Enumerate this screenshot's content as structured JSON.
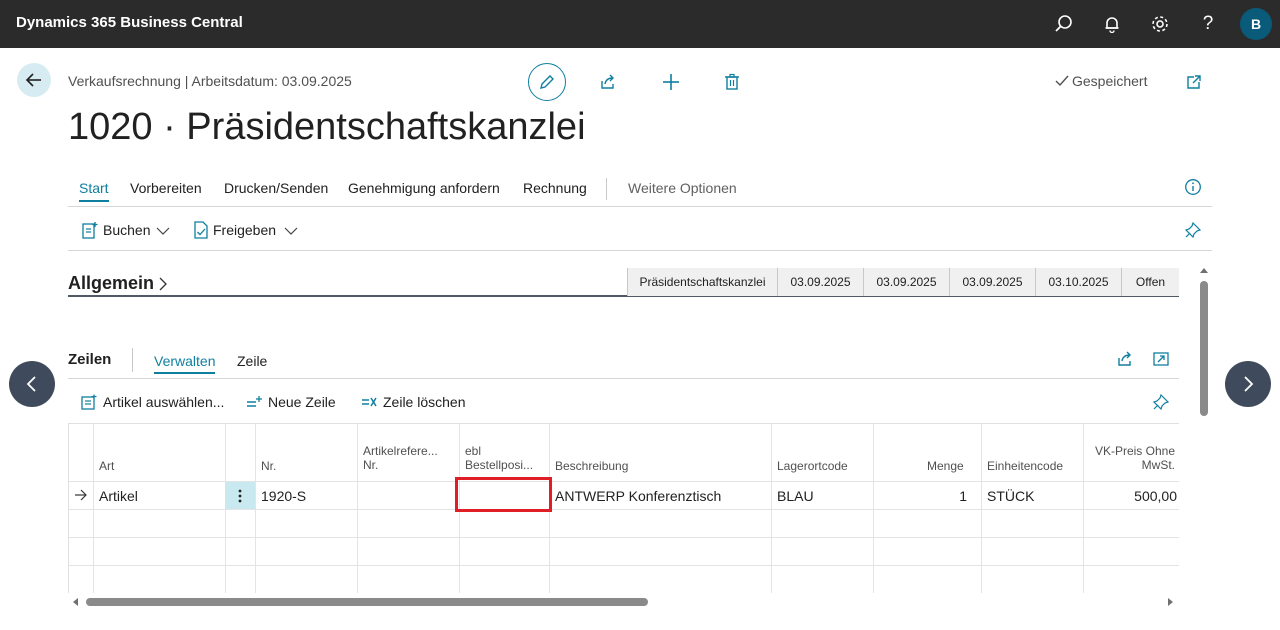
{
  "topbar": {
    "app_title": "Dynamics 365 Business Central",
    "avatar_initial": "B",
    "icons": [
      "search-icon",
      "bell-icon",
      "gear-icon",
      "help-icon"
    ]
  },
  "header": {
    "breadcrumb": "Verkaufsrechnung | Arbeitsdatum: 03.09.2025",
    "saved_label": "Gespeichert",
    "title": "1020 · Präsidentschaftskanzlei"
  },
  "tabs": {
    "items": [
      "Start",
      "Vorbereiten",
      "Drucken/Senden",
      "Genehmigung anfordern",
      "Rechnung"
    ],
    "more": "Weitere Optionen",
    "active": "Start"
  },
  "actions": {
    "post": "Buchen",
    "release": "Freigeben"
  },
  "general": {
    "title": "Allgemein",
    "facts": [
      "Präsidentschaftskanzlei",
      "03.09.2025",
      "03.09.2025",
      "03.09.2025",
      "03.10.2025",
      "Offen"
    ]
  },
  "lines": {
    "title": "Zeilen",
    "subtabs": [
      "Verwalten",
      "Zeile"
    ],
    "active_subtab": "Verwalten",
    "actions": [
      "Artikel auswählen...",
      "Neue Zeile",
      "Zeile löschen"
    ],
    "columns": {
      "art": "Art",
      "nr": "Nr.",
      "artref_1": "Artikelrefere...",
      "artref_2": "Nr.",
      "ebl_1": "ebl",
      "ebl_2": "Bestellposi...",
      "beschreibung": "Beschreibung",
      "lagerort": "Lagerortcode",
      "menge": "Menge",
      "einheit": "Einheitencode",
      "vk_1": "VK-Preis Ohne",
      "vk_2": "MwSt."
    },
    "rows": [
      {
        "art": "Artikel",
        "nr": "1920-S",
        "artref": "",
        "ebl": "",
        "beschreibung": "ANTWERP Konferenztisch",
        "lagerort": "BLAU",
        "menge": "1",
        "einheit": "STÜCK",
        "vk": "500,00"
      }
    ]
  },
  "colors": {
    "topbar": "#2b2b2b",
    "accent": "#0f7fa0",
    "avatar": "#0a5b7a",
    "highlight": "#e01e26"
  }
}
